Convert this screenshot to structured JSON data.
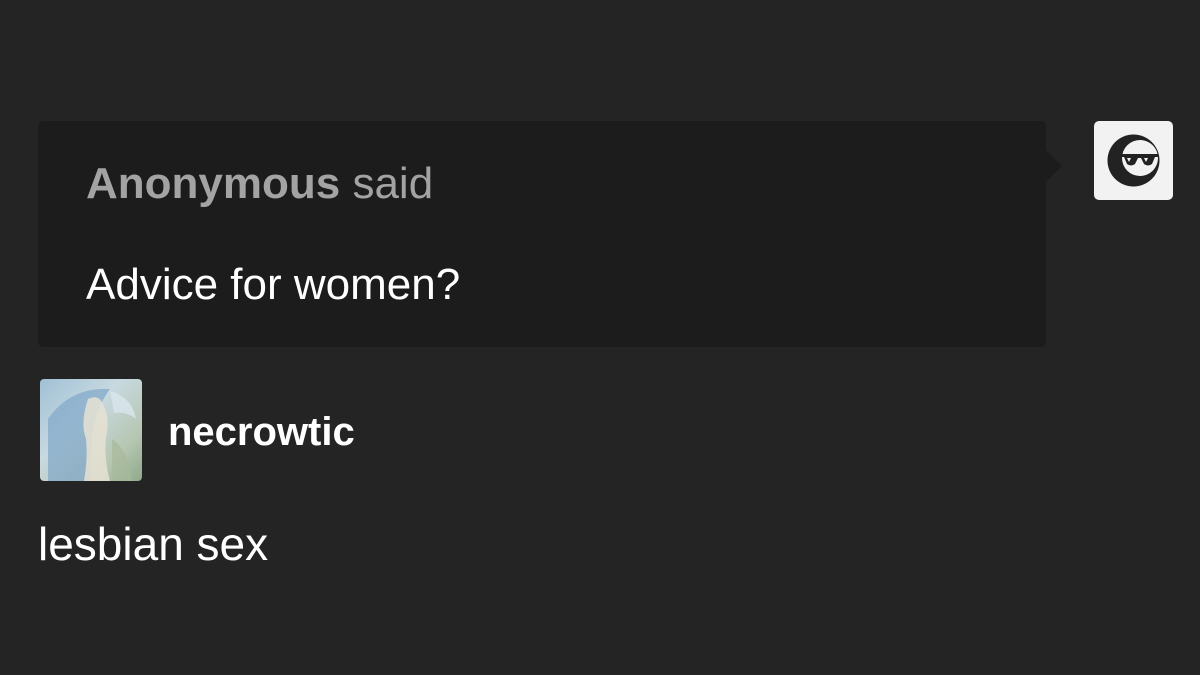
{
  "ask": {
    "asker_name": "Anonymous",
    "said_label": " said",
    "question": "Advice for women?",
    "avatar_icon": "anonymous-sunglasses-icon"
  },
  "answer": {
    "username": "necrowtic",
    "avatar_icon": "blog-avatar-image",
    "text": "lesbian sex"
  },
  "colors": {
    "background": "#242424",
    "ask_bubble": "#1c1c1c",
    "asker_text": "#a3a3a3",
    "text": "#ffffff"
  }
}
